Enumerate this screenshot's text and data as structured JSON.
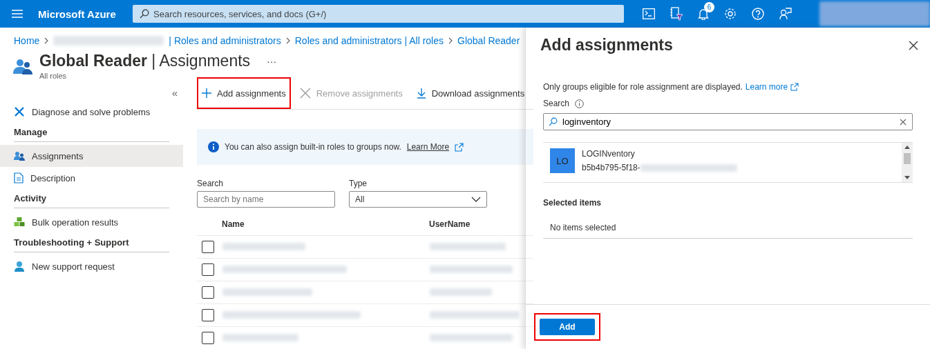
{
  "top_bar": {
    "brand": "Microsoft Azure",
    "search_placeholder": "Search resources, services, and docs (G+/)",
    "notification_count": "6"
  },
  "breadcrumb": [
    {
      "label": "Home",
      "redacted_prefix": false
    },
    {
      "label": "| Roles and administrators",
      "redacted_prefix": true
    },
    {
      "label": "Roles and administrators | All roles",
      "redacted_prefix": false
    },
    {
      "label": "Global Reader",
      "redacted_prefix": false
    }
  ],
  "page": {
    "title": "Global Reader",
    "subtitle": "| Assignments",
    "more": "···",
    "caption": "All roles"
  },
  "sidebar": {
    "collapse": "«",
    "items": [
      {
        "kind": "item",
        "label": "Diagnose and solve problems",
        "selected": false
      },
      {
        "kind": "heading",
        "label": "Manage"
      },
      {
        "kind": "item",
        "label": "Assignments",
        "selected": true
      },
      {
        "kind": "item",
        "label": "Description",
        "selected": false
      },
      {
        "kind": "heading",
        "label": "Activity"
      },
      {
        "kind": "item",
        "label": "Bulk operation results",
        "selected": false
      },
      {
        "kind": "heading",
        "label": "Troubleshooting + Support"
      },
      {
        "kind": "item",
        "label": "New support request",
        "selected": false
      }
    ]
  },
  "toolbar": [
    {
      "label": "Add assignments",
      "disabled": false,
      "highlighted": true
    },
    {
      "label": "Remove assignments",
      "disabled": true,
      "highlighted": false
    },
    {
      "label": "Download assignments",
      "disabled": false,
      "highlighted": false
    }
  ],
  "info_banner": {
    "text": "You can also assign built-in roles to groups now.",
    "link": "Learn More"
  },
  "filters": {
    "search_label": "Search",
    "search_placeholder": "Search by name",
    "type_label": "Type",
    "type_value": "All"
  },
  "table": {
    "columns": [
      "Name",
      "UserName"
    ],
    "rows": [
      {
        "checked": false
      },
      {
        "checked": false
      },
      {
        "checked": false
      },
      {
        "checked": false
      },
      {
        "checked": false
      }
    ]
  },
  "panel": {
    "title": "Add assignments",
    "note": "Only groups eligible for role assignment are displayed.",
    "link": "Learn more",
    "search_label": "Search",
    "search_value": "loginventory",
    "results": [
      {
        "initials": "LO",
        "name": "LOGINventory",
        "id": "b5b4b795-5f18-"
      }
    ],
    "selected_heading": "Selected items",
    "empty_text": "No items selected",
    "add_button": {
      "label": "Add",
      "highlighted": true
    }
  }
}
